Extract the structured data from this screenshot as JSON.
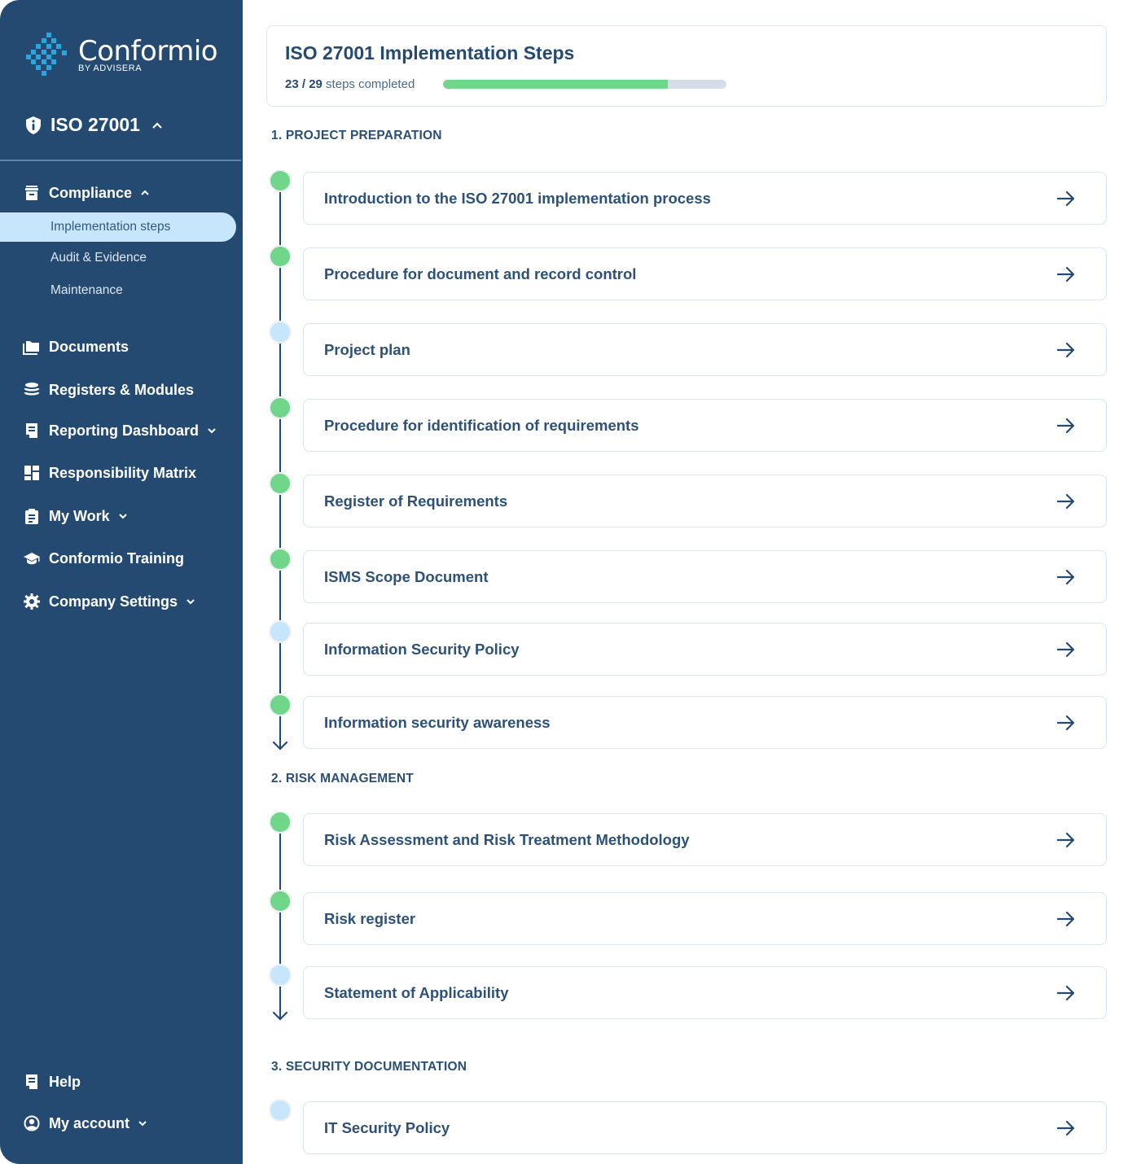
{
  "brand": {
    "name": "Conformio",
    "byline": "BY ADVISERA",
    "accent": "#2aa5dd"
  },
  "sidebar": {
    "standard_selector": {
      "label": "ISO 27001",
      "icon": "shield-info-icon",
      "expanded": true
    },
    "compliance": {
      "label": "Compliance",
      "icon": "archive-box-icon",
      "expanded": true,
      "children": [
        {
          "label": "Implementation steps",
          "active": true
        },
        {
          "label": "Audit & Evidence",
          "active": false
        },
        {
          "label": "Maintenance",
          "active": false
        }
      ]
    },
    "items": [
      {
        "label": "Documents",
        "icon": "folder-icon",
        "has_dropdown": false
      },
      {
        "label": "Registers & Modules",
        "icon": "database-icon",
        "has_dropdown": false
      },
      {
        "label": "Reporting Dashboard",
        "icon": "report-icon",
        "has_dropdown": true
      },
      {
        "label": "Responsibility Matrix",
        "icon": "grid-icon",
        "has_dropdown": false
      },
      {
        "label": "My Work",
        "icon": "clipboard-icon",
        "has_dropdown": true
      },
      {
        "label": "Conformio Training",
        "icon": "graduation-cap-icon",
        "has_dropdown": false
      },
      {
        "label": "Company Settings",
        "icon": "gear-icon",
        "has_dropdown": true
      }
    ],
    "bottom": [
      {
        "label": "Help",
        "icon": "help-book-icon",
        "has_dropdown": false
      },
      {
        "label": "My account",
        "icon": "user-circle-icon",
        "has_dropdown": true
      }
    ],
    "colors": {
      "background": "#244a72",
      "active_bg": "#c8e6fb"
    }
  },
  "header": {
    "title": "ISO 27001 Implementation Steps",
    "completed": "23",
    "total": "29",
    "separator": " / ",
    "progress_suffix": " steps completed",
    "progress_fraction": 0.793,
    "colors": {
      "fill": "#6fd68a",
      "track": "#d5dde6"
    }
  },
  "sections": [
    {
      "title": "1. PROJECT PREPARATION",
      "steps": [
        {
          "label": "Introduction to the ISO 27001 implementation process",
          "status": "done"
        },
        {
          "label": "Procedure for document and record control",
          "status": "done"
        },
        {
          "label": "Project plan",
          "status": "todo"
        },
        {
          "label": "Procedure for identification of requirements",
          "status": "done"
        },
        {
          "label": "Register of Requirements",
          "status": "done"
        },
        {
          "label": "ISMS Scope Document",
          "status": "done"
        },
        {
          "label": "Information Security Policy",
          "status": "todo"
        },
        {
          "label": "Information security awareness",
          "status": "done"
        }
      ]
    },
    {
      "title": "2. RISK MANAGEMENT",
      "steps": [
        {
          "label": "Risk Assessment and Risk Treatment Methodology",
          "status": "done"
        },
        {
          "label": "Risk register",
          "status": "done"
        },
        {
          "label": "Statement of Applicability",
          "status": "todo"
        }
      ]
    },
    {
      "title": "3. SECURITY DOCUMENTATION",
      "steps": [
        {
          "label": "IT Security Policy",
          "status": "todo"
        }
      ]
    }
  ],
  "status_colors": {
    "done": "#6fd68a",
    "todo": "#c8e6fb"
  }
}
